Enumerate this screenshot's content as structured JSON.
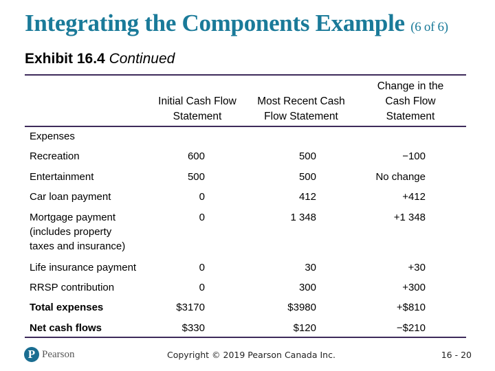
{
  "slide": {
    "title": "Integrating the Components Example",
    "title_suffix": "(6 of 6)",
    "exhibit_bold": "Exhibit 16.4",
    "exhibit_italic": "Continued"
  },
  "table": {
    "headers": {
      "col1_line1": "Initial Cash Flow",
      "col1_line2": "Statement",
      "col2_line1": "Most Recent Cash",
      "col2_line2": "Flow Statement",
      "col3_line1": "Change in the",
      "col3_line2": "Cash Flow",
      "col3_line3": "Statement"
    },
    "section_label": "Expenses",
    "rows": [
      {
        "label": "Recreation",
        "initial": "600",
        "recent": "500",
        "change": "−100"
      },
      {
        "label": "Entertainment",
        "initial": "500",
        "recent": "500",
        "change": "No change"
      },
      {
        "label": "Car loan payment",
        "initial": "0",
        "recent": "412",
        "change": "+412"
      },
      {
        "label_line1": "Mortgage payment",
        "label_line2": "(includes property",
        "label_line3": "taxes and insurance)",
        "initial": "0",
        "recent": "1 348",
        "change": "+1 348"
      },
      {
        "label": "Life insurance payment",
        "initial": "0",
        "recent": "30",
        "change": "+30"
      },
      {
        "label": "RRSP contribution",
        "initial": "0",
        "recent": "300",
        "change": "+300"
      },
      {
        "label": "Total expenses",
        "initial": "$3170",
        "recent": "$3980",
        "change": "+$810"
      },
      {
        "label": "Net cash flows",
        "initial": "$330",
        "recent": "$120",
        "change": "−$210"
      }
    ]
  },
  "footer": {
    "logo_letter": "P",
    "logo_text": "Pearson",
    "copyright": "Copyright © 2019 Pearson Canada Inc.",
    "page": "16 - 20"
  },
  "colors": {
    "title": "#1a7a99",
    "rule": "#3d2a5a",
    "logo": "#1a6d91"
  }
}
